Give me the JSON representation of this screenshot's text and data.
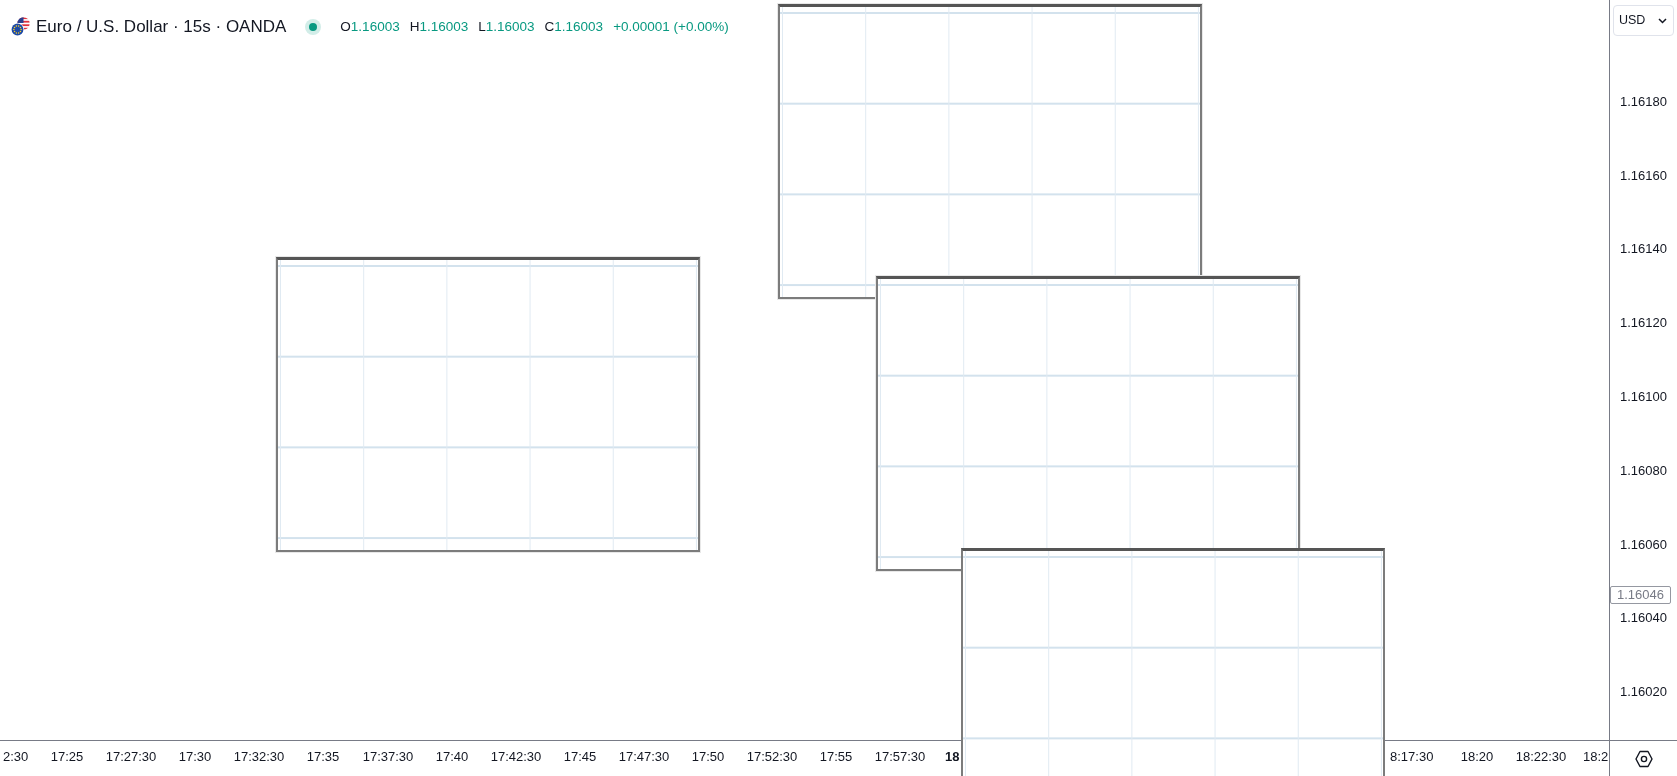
{
  "legend": {
    "symbol": "Euro / U.S. Dollar · 15s · OANDA",
    "market_open": true,
    "rising": true,
    "ohlc": [
      {
        "label": "O",
        "value": "1.16003"
      },
      {
        "label": "H",
        "value": "1.16003"
      },
      {
        "label": "L",
        "value": "1.16003"
      },
      {
        "label": "C",
        "value": "1.16003"
      }
    ],
    "change": "+0.00001 (+0.00%)"
  },
  "price_axis": {
    "currency": "USD",
    "labels": [
      "1.16180",
      "1.16160",
      "1.16140",
      "1.16120",
      "1.16100",
      "1.16080",
      "1.16060",
      "1.16040",
      "1.16020"
    ],
    "current_price": "1.16046"
  },
  "time_axis": {
    "labels": [
      {
        "text": "2:30",
        "major": false
      },
      {
        "text": "17:25",
        "major": false
      },
      {
        "text": "17:27:30",
        "major": false
      },
      {
        "text": "17:30",
        "major": false
      },
      {
        "text": "17:32:30",
        "major": false
      },
      {
        "text": "17:35",
        "major": false
      },
      {
        "text": "17:37:30",
        "major": false
      },
      {
        "text": "17:40",
        "major": false
      },
      {
        "text": "17:42:30",
        "major": false
      },
      {
        "text": "17:45",
        "major": false
      },
      {
        "text": "17:47:30",
        "major": false
      },
      {
        "text": "17:50",
        "major": false
      },
      {
        "text": "17:52:30",
        "major": false
      },
      {
        "text": "17:55",
        "major": false
      },
      {
        "text": "17:57:30",
        "major": false
      },
      {
        "text": "18",
        "major": true
      },
      {
        "text": "8:17:30",
        "major": false
      },
      {
        "text": "18:20",
        "major": false
      },
      {
        "text": "18:22:30",
        "major": false
      },
      {
        "text": "18:2",
        "major": false
      }
    ]
  }
}
